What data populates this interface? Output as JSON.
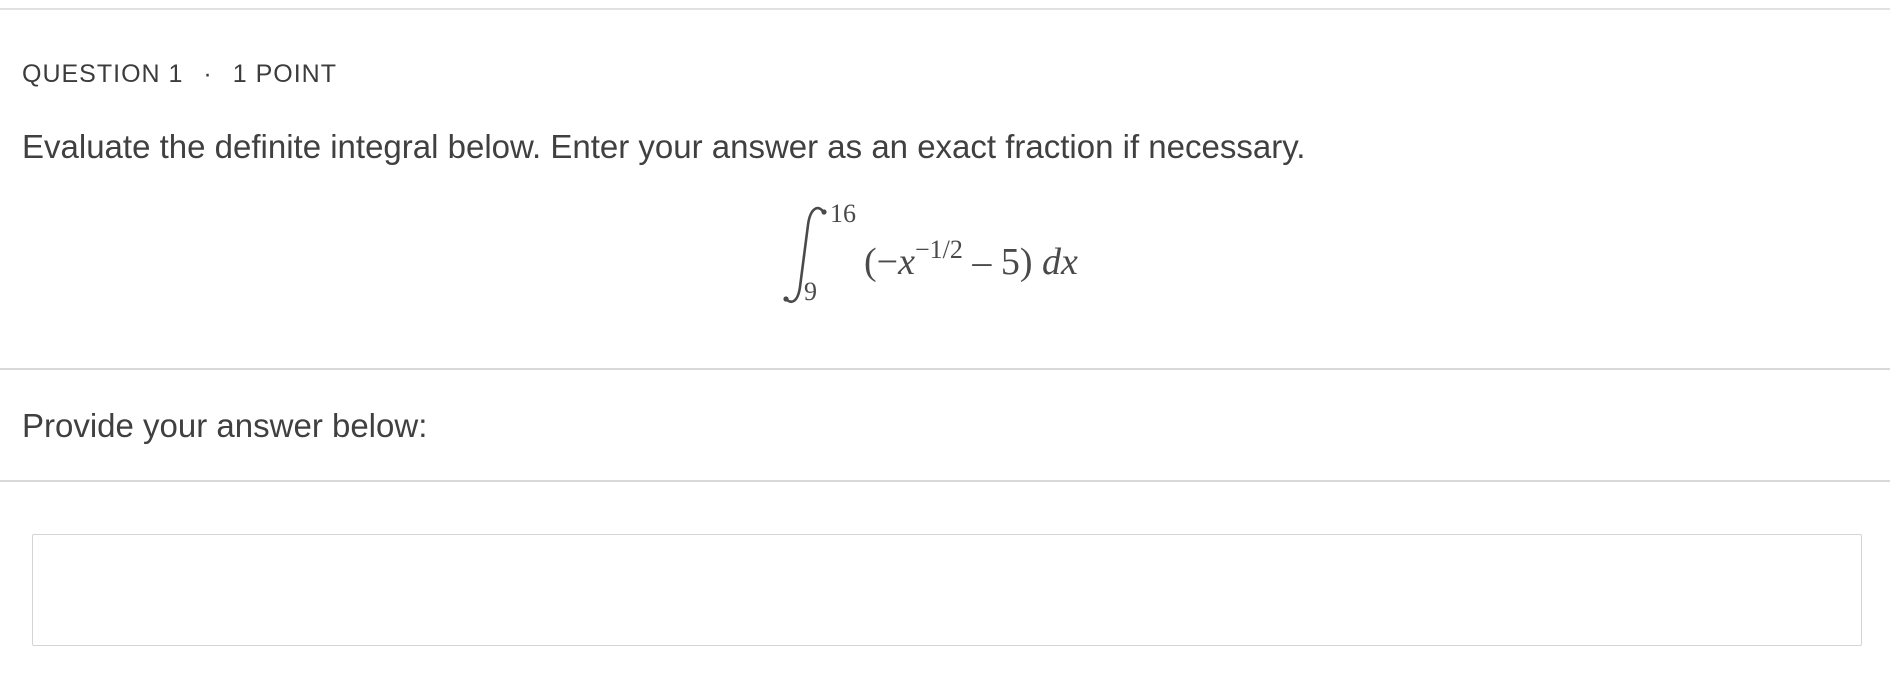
{
  "question": {
    "number_label": "QUESTION 1",
    "separator": "·",
    "points_label": "1 POINT",
    "prompt": "Evaluate the definite integral below. Enter your answer as an exact fraction if necessary."
  },
  "integral": {
    "upper_limit": "16",
    "lower_limit": "9",
    "open_paren": "(",
    "minus": "−",
    "variable": "x",
    "exponent": "−1/2",
    "rest": " – 5) ",
    "differential": "dx"
  },
  "answer": {
    "label": "Provide your answer below:",
    "value": "",
    "placeholder": ""
  }
}
